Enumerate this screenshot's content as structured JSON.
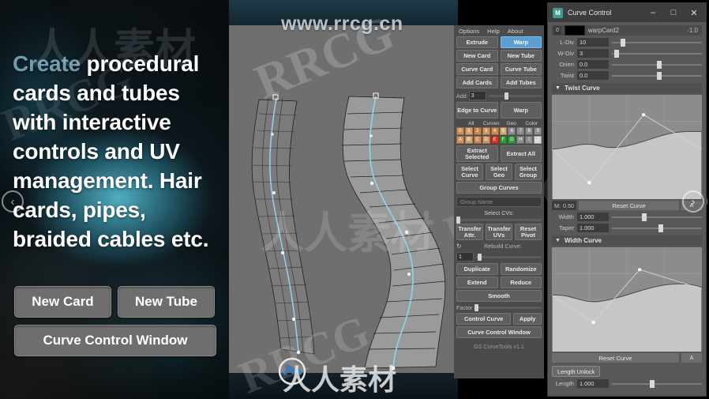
{
  "promo": {
    "headline_highlight": "Create",
    "headline_rest": " procedural cards and tubes with interactive controls and UV management. Hair cards, pipes, braided cables etc.",
    "buttons": {
      "new_card": "New Card",
      "new_tube": "New Tube",
      "curve_control_window": "Curve Control Window"
    },
    "prev_arrow": "‹",
    "next_arrow": "›"
  },
  "watermarks": {
    "url": "www.rrcg.cn",
    "rrcg": "RRCG",
    "cn_mark": "人人素材",
    "bottom_text": "人人素材"
  },
  "tool_panel": {
    "menu": [
      "Options",
      "Help",
      "About"
    ],
    "mode_row": [
      {
        "label": "Extrude",
        "selected": false
      },
      {
        "label": "Warp",
        "selected": true
      }
    ],
    "rows": [
      [
        "New Card",
        "New Tube"
      ],
      [
        "Curve Card",
        "Curve Tube"
      ],
      [
        "Add Cards",
        "Add Tubes"
      ]
    ],
    "add_slider": {
      "label": "Add",
      "value": "3"
    },
    "mode_row2": [
      {
        "label": "Edge to Curve"
      },
      {
        "label": "Warp"
      }
    ],
    "palette": {
      "headers": [
        "All",
        "Curves",
        "Geo",
        "Color"
      ],
      "row1": [
        {
          "label": "0",
          "color": "#c98f5e"
        },
        {
          "label": "1",
          "color": "#d3a072"
        },
        {
          "label": "2",
          "color": "#c9854f"
        },
        {
          "label": "3",
          "color": "#cf9463"
        },
        {
          "label": "4",
          "color": "#c88a54"
        },
        {
          "label": "5",
          "color": "#d7a877"
        },
        {
          "label": "6",
          "color": "#8d8d8d"
        },
        {
          "label": "7",
          "color": "#8d8d8d"
        },
        {
          "label": "8",
          "color": "#8d8d8d"
        },
        {
          "label": "9",
          "color": "#8d8d8d"
        }
      ],
      "row2": [
        {
          "label": "A",
          "color": "#c98f5e"
        },
        {
          "label": "B",
          "color": "#d3a072"
        },
        {
          "label": "C",
          "color": "#c98a58"
        },
        {
          "label": "D",
          "color": "#cf9463"
        },
        {
          "label": "E",
          "color": "#d4342c"
        },
        {
          "label": "F",
          "color": "#2f9b3e"
        },
        {
          "label": "G",
          "color": "#2f9b47"
        },
        {
          "label": "H",
          "color": "#8d8d8d"
        },
        {
          "label": "I",
          "color": "#8d8d8d"
        },
        {
          "label": "J",
          "color": "#d7d7d7"
        }
      ]
    },
    "extract": [
      "Extract Selected",
      "Extract All"
    ],
    "select": [
      "Select Curve",
      "Select Geo",
      "Select Group"
    ],
    "group_curves": "Group Curves",
    "group_name_placeholder": "Group Name",
    "select_cvs": "Select CVs:",
    "transfer": [
      "Transfer Attr.",
      "Transfer UVs",
      "Reset Pivot"
    ],
    "rebuild_curve": {
      "label": "Rebuild Curve:",
      "value": "1",
      "icon": "refresh-icon"
    },
    "ops": [
      [
        "Duplicate",
        "Randomize"
      ],
      [
        "Extend",
        "Reduce"
      ]
    ],
    "smooth": "Smooth",
    "factor": "Factor",
    "control_row": [
      "Control Curve",
      "Apply"
    ],
    "curve_control_window": "Curve Control Window",
    "footer": "GS CurveTools v1.1"
  },
  "curve_control": {
    "title": "Curve Control",
    "icon": "app-icon",
    "window_buttons": {
      "minimize": "–",
      "maximize": "□",
      "close": "✕"
    },
    "object": {
      "index": "0",
      "color": "#000000",
      "name": "warpCard2",
      "value": "-1.0"
    },
    "params": [
      {
        "label": "L-Div",
        "value": "10",
        "knob_pct": 10
      },
      {
        "label": "W-Div",
        "value": "3",
        "knob_pct": 3
      },
      {
        "label": "Orien",
        "value": "0.0",
        "knob_pct": 50
      },
      {
        "label": "Twist",
        "value": "0.0",
        "knob_pct": 50
      }
    ],
    "twist_curve": {
      "section_label": "Twist Curve",
      "reset": "Reset Curve",
      "m_label": "M:",
      "m_value": "0.50",
      "small_button": "A"
    },
    "width_taper": [
      {
        "label": "Width",
        "value": "1.000",
        "knob_pct": 33
      },
      {
        "label": "Taper",
        "value": "1.000",
        "knob_pct": 52
      }
    ],
    "width_curve": {
      "section_label": "Width Curve",
      "reset": "Reset Curve",
      "small_button": "A"
    },
    "length": {
      "lock_button": "Length Unlock",
      "label": "Length",
      "value": "1.000",
      "knob_pct": 42
    }
  }
}
